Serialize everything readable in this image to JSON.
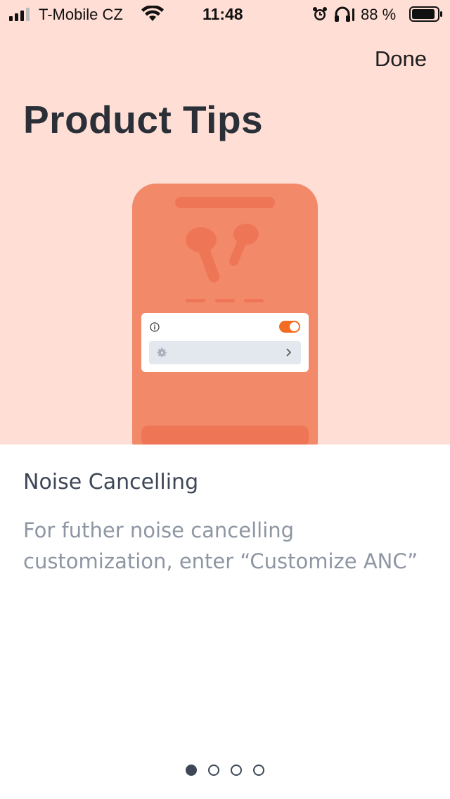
{
  "status_bar": {
    "carrier": "T-Mobile CZ",
    "time": "11:48",
    "battery_percent": "88 %",
    "icons": [
      "signal-icon",
      "wifi-icon",
      "alarm-icon",
      "headphones-icon",
      "battery-icon"
    ]
  },
  "header": {
    "done_label": "Done",
    "title": "Product Tips"
  },
  "illustration": {
    "toggle_on": true,
    "colors": {
      "background": "#ffdfd5",
      "phone": "#f28a6a",
      "phone_shade": "#ee7656",
      "toggle": "#f36c22",
      "card_row": "#e3e8ee"
    }
  },
  "tip": {
    "title": "Noise Cancelling",
    "body": "For futher noise cancelling customization, enter “Customize ANC”"
  },
  "pager": {
    "total_pages": 4,
    "current_page": 1
  }
}
